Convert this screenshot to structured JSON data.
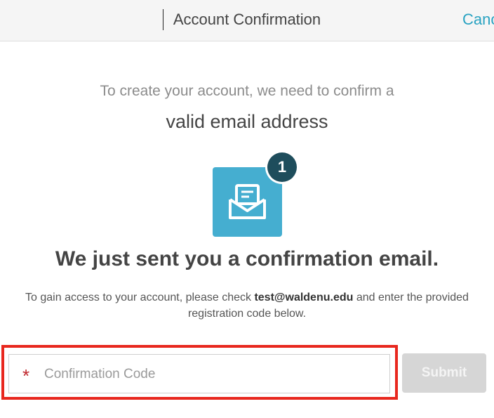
{
  "header": {
    "title": "Account Confirmation",
    "cancel_label": "Cancel"
  },
  "intro": {
    "line1": "To create your account, we need to confirm a",
    "line2": "valid email address"
  },
  "notification": {
    "icon": "envelope-letter-icon",
    "badge_count": "1",
    "tile_color": "#45aed0",
    "badge_color": "#1e4d5c"
  },
  "headline": "We just sent you a confirmation email.",
  "instructions": {
    "before": "To gain access to your account, please check ",
    "email": "test@waldenu.edu",
    "after": " and enter the provided registration code below."
  },
  "form": {
    "required_marker": "*",
    "code_placeholder": "Confirmation Code",
    "code_value": "",
    "submit_label": "Submit"
  },
  "colors": {
    "accent": "#2aa3c2",
    "required": "#c0272d",
    "highlight": "#e8271e"
  }
}
